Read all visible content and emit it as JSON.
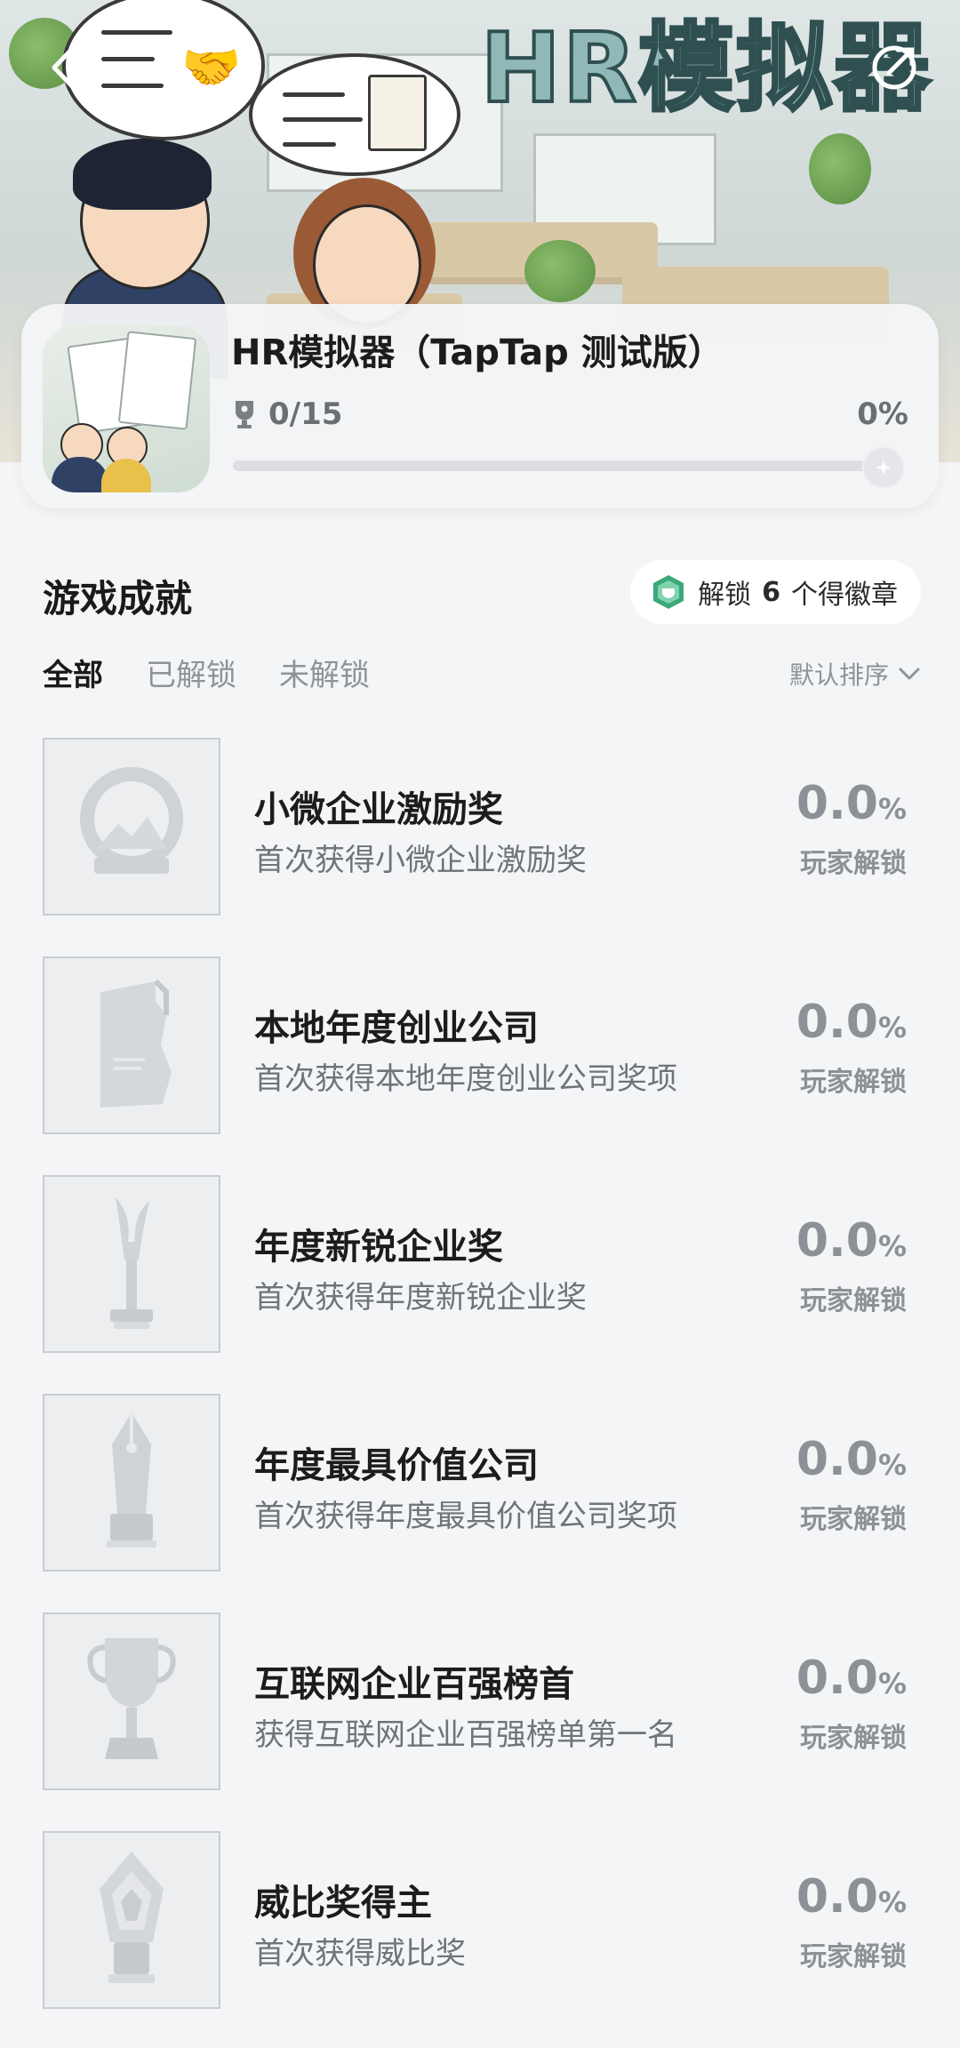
{
  "hero": {
    "title": "HR模拟器"
  },
  "nav": {
    "back_icon": "chevron-left-icon",
    "share_icon": "share-icon"
  },
  "game": {
    "title": "HR模拟器（TapTap 测试版）",
    "trophy_icon": "trophy-icon",
    "progress_text": "0/15",
    "percent_text": "0%",
    "progress_fraction": 0.0
  },
  "section": {
    "title": "游戏成就",
    "badge_prefix": "解锁",
    "badge_count": "6",
    "badge_suffix": "个得徽章"
  },
  "tabs": [
    {
      "label": "全部",
      "active": true
    },
    {
      "label": "已解锁",
      "active": false
    },
    {
      "label": "未解锁",
      "active": false
    }
  ],
  "sort": {
    "label": "默认排序",
    "icon": "chevron-down-icon"
  },
  "achievements": [
    {
      "name": "小微企业激励奖",
      "desc": "首次获得小微企业激励奖",
      "rate": "0.0",
      "unit": "%",
      "rate_label": "玩家解锁",
      "icon": "ring-trophy-icon"
    },
    {
      "name": "本地年度创业公司",
      "desc": "首次获得本地年度创业公司奖项",
      "rate": "0.0",
      "unit": "%",
      "rate_label": "玩家解锁",
      "icon": "map-plaque-icon"
    },
    {
      "name": "年度新锐企业奖",
      "desc": "首次获得年度新锐企业奖",
      "rate": "0.0",
      "unit": "%",
      "rate_label": "玩家解锁",
      "icon": "torch-trophy-icon"
    },
    {
      "name": "年度最具价值公司",
      "desc": "首次获得年度最具价值公司奖项",
      "rate": "0.0",
      "unit": "%",
      "rate_label": "玩家解锁",
      "icon": "pen-trophy-icon"
    },
    {
      "name": "互联网企业百强榜首",
      "desc": "获得互联网企业百强榜单第一名",
      "rate": "0.0",
      "unit": "%",
      "rate_label": "玩家解锁",
      "icon": "cup-trophy-icon"
    },
    {
      "name": "威比奖得主",
      "desc": "首次获得威比奖",
      "rate": "0.0",
      "unit": "%",
      "rate_label": "玩家解锁",
      "icon": "crystal-trophy-icon"
    }
  ]
}
